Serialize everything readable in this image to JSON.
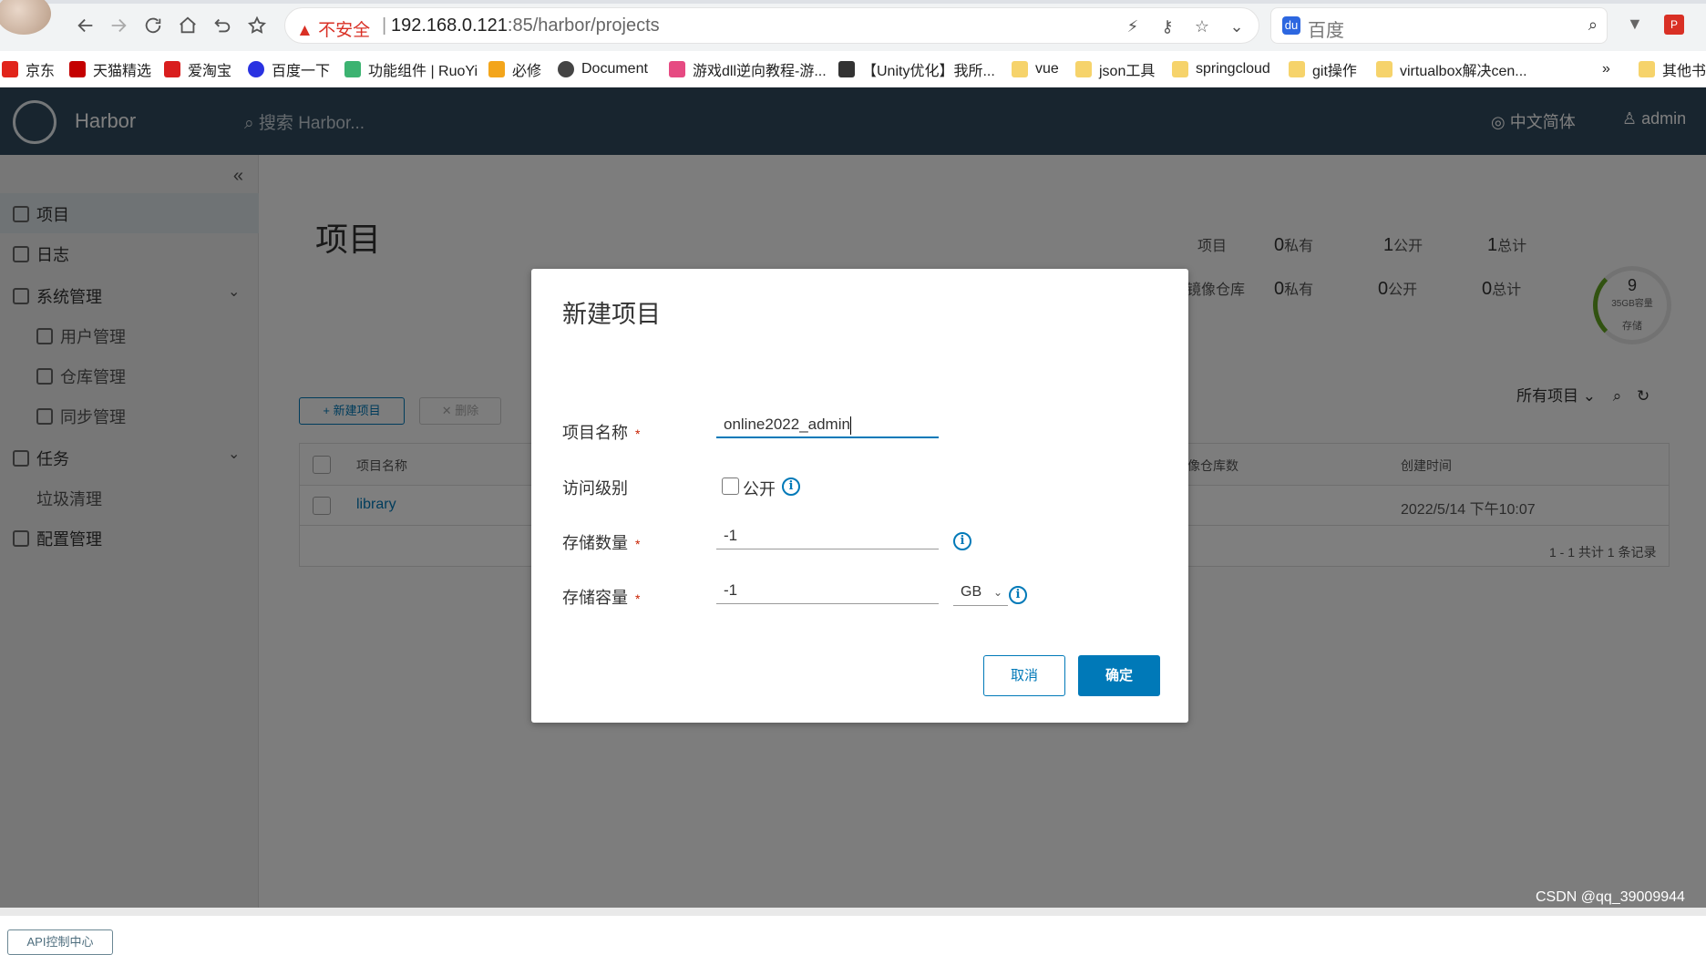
{
  "browser": {
    "url_warning": "不安全",
    "url_host": "192.168.0.121",
    "url_path": ":85/harbor/projects",
    "search_engine": "百度",
    "bookmarks": [
      {
        "label": "京东",
        "color": "#e1251b"
      },
      {
        "label": "天猫精选",
        "color": "#c40000"
      },
      {
        "label": "爱淘宝",
        "color": "#d91e1e"
      },
      {
        "label": "百度一下",
        "color": "#2932e1"
      },
      {
        "label": "功能组件 | RuoYi",
        "color": "#3cb371"
      },
      {
        "label": "必修",
        "color": "#f3a51b"
      },
      {
        "label": "Document",
        "color": "#444444"
      },
      {
        "label": "游戏dll逆向教程-游...",
        "color": "#e64a82"
      },
      {
        "label": "【Unity优化】我所...",
        "color": "#333333"
      },
      {
        "label": "vue",
        "color": "#f6d36b"
      },
      {
        "label": "json工具",
        "color": "#f6d36b"
      },
      {
        "label": "springcloud",
        "color": "#f6d36b"
      },
      {
        "label": "git操作",
        "color": "#f6d36b"
      },
      {
        "label": "virtualbox解决cen...",
        "color": "#f6d36b"
      },
      {
        "label": "其他书",
        "color": "#f6d36b"
      }
    ],
    "more": "»"
  },
  "harbor": {
    "brand": "Harbor",
    "search_placeholder": "搜索 Harbor...",
    "language": "中文简体",
    "user": "admin",
    "sidebar": [
      {
        "label": "项目",
        "sub": false
      },
      {
        "label": "日志",
        "sub": false
      },
      {
        "label": "系统管理",
        "sub": false
      },
      {
        "label": "用户管理",
        "sub": true
      },
      {
        "label": "仓库管理",
        "sub": true
      },
      {
        "label": "同步管理",
        "sub": true
      },
      {
        "label": "任务",
        "sub": false
      },
      {
        "label": "垃圾清理",
        "sub": true
      },
      {
        "label": "配置管理",
        "sub": false
      }
    ],
    "api_center": "API控制中心",
    "page_title": "项目",
    "stats": {
      "row1_label": "项目",
      "row1_private": "0",
      "row1_public": "1",
      "row1_total": "1",
      "row2_label": "镜像仓库",
      "row2_private": "0",
      "row2_public": "0",
      "row2_total": "0",
      "private_label": "私有",
      "public_label": "公开",
      "total_label": "总计",
      "storage_value": "9",
      "storage_cap": "35GB容量",
      "storage_label": "存储"
    },
    "new_project_btn": "+ 新建项目",
    "delete_btn": "✕ 删除",
    "filter": "所有项目",
    "columns": [
      "项目名称",
      "镜像仓库数",
      "创建时间"
    ],
    "rows": [
      {
        "name": "library",
        "created": "2022/5/14 下午10:07"
      }
    ],
    "footer": "1 - 1 共计 1 条记录"
  },
  "modal": {
    "title": "新建项目",
    "name_label": "项目名称",
    "name_value": "online2022_admin",
    "access_label": "访问级别",
    "public_label": "公开",
    "count_label": "存储数量",
    "count_value": "-1",
    "capacity_label": "存储容量",
    "capacity_value": "-1",
    "unit": "GB",
    "cancel": "取消",
    "ok": "确定",
    "required_mark": "*"
  },
  "watermark": "CSDN @qq_39009944",
  "colors": {
    "primary": "#0079b8",
    "header": "#314b5e",
    "required": "#c92100"
  }
}
